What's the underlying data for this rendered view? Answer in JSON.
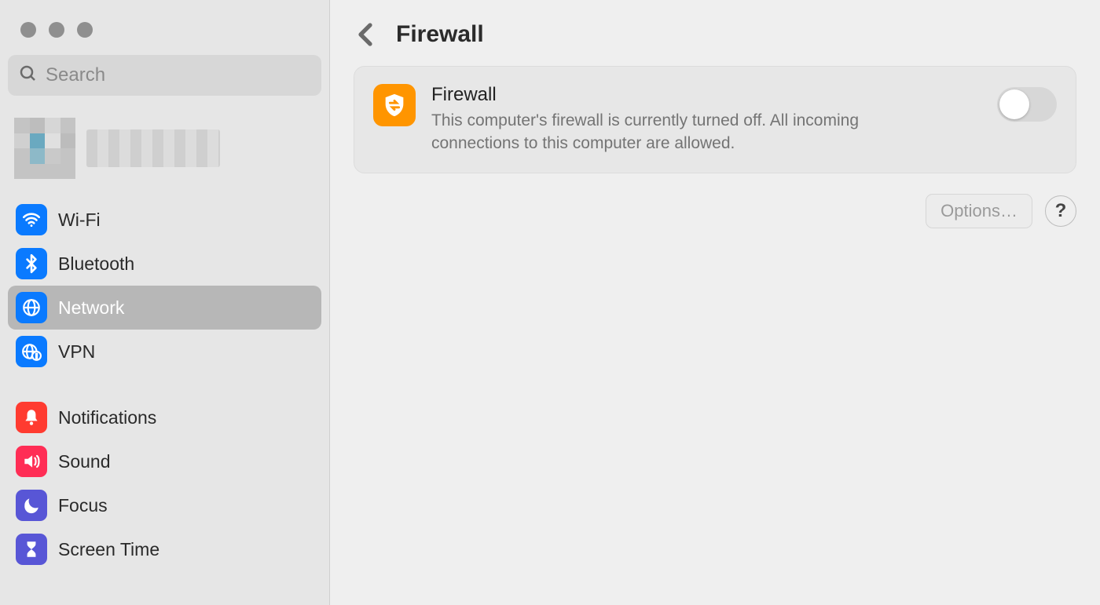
{
  "window": {
    "search_placeholder": "Search"
  },
  "sidebar": {
    "groups": [
      {
        "items": [
          {
            "id": "wifi",
            "label": "Wi-Fi"
          },
          {
            "id": "bluetooth",
            "label": "Bluetooth"
          },
          {
            "id": "network",
            "label": "Network",
            "selected": true
          },
          {
            "id": "vpn",
            "label": "VPN"
          }
        ]
      },
      {
        "items": [
          {
            "id": "notifications",
            "label": "Notifications"
          },
          {
            "id": "sound",
            "label": "Sound"
          },
          {
            "id": "focus",
            "label": "Focus"
          },
          {
            "id": "screentime",
            "label": "Screen Time"
          }
        ]
      }
    ]
  },
  "header": {
    "title": "Firewall"
  },
  "firewall_card": {
    "title": "Firewall",
    "description": "This computer's firewall is currently turned off. All incoming connections to this computer are allowed.",
    "enabled": false
  },
  "actions": {
    "options_label": "Options…",
    "help_label": "?"
  }
}
